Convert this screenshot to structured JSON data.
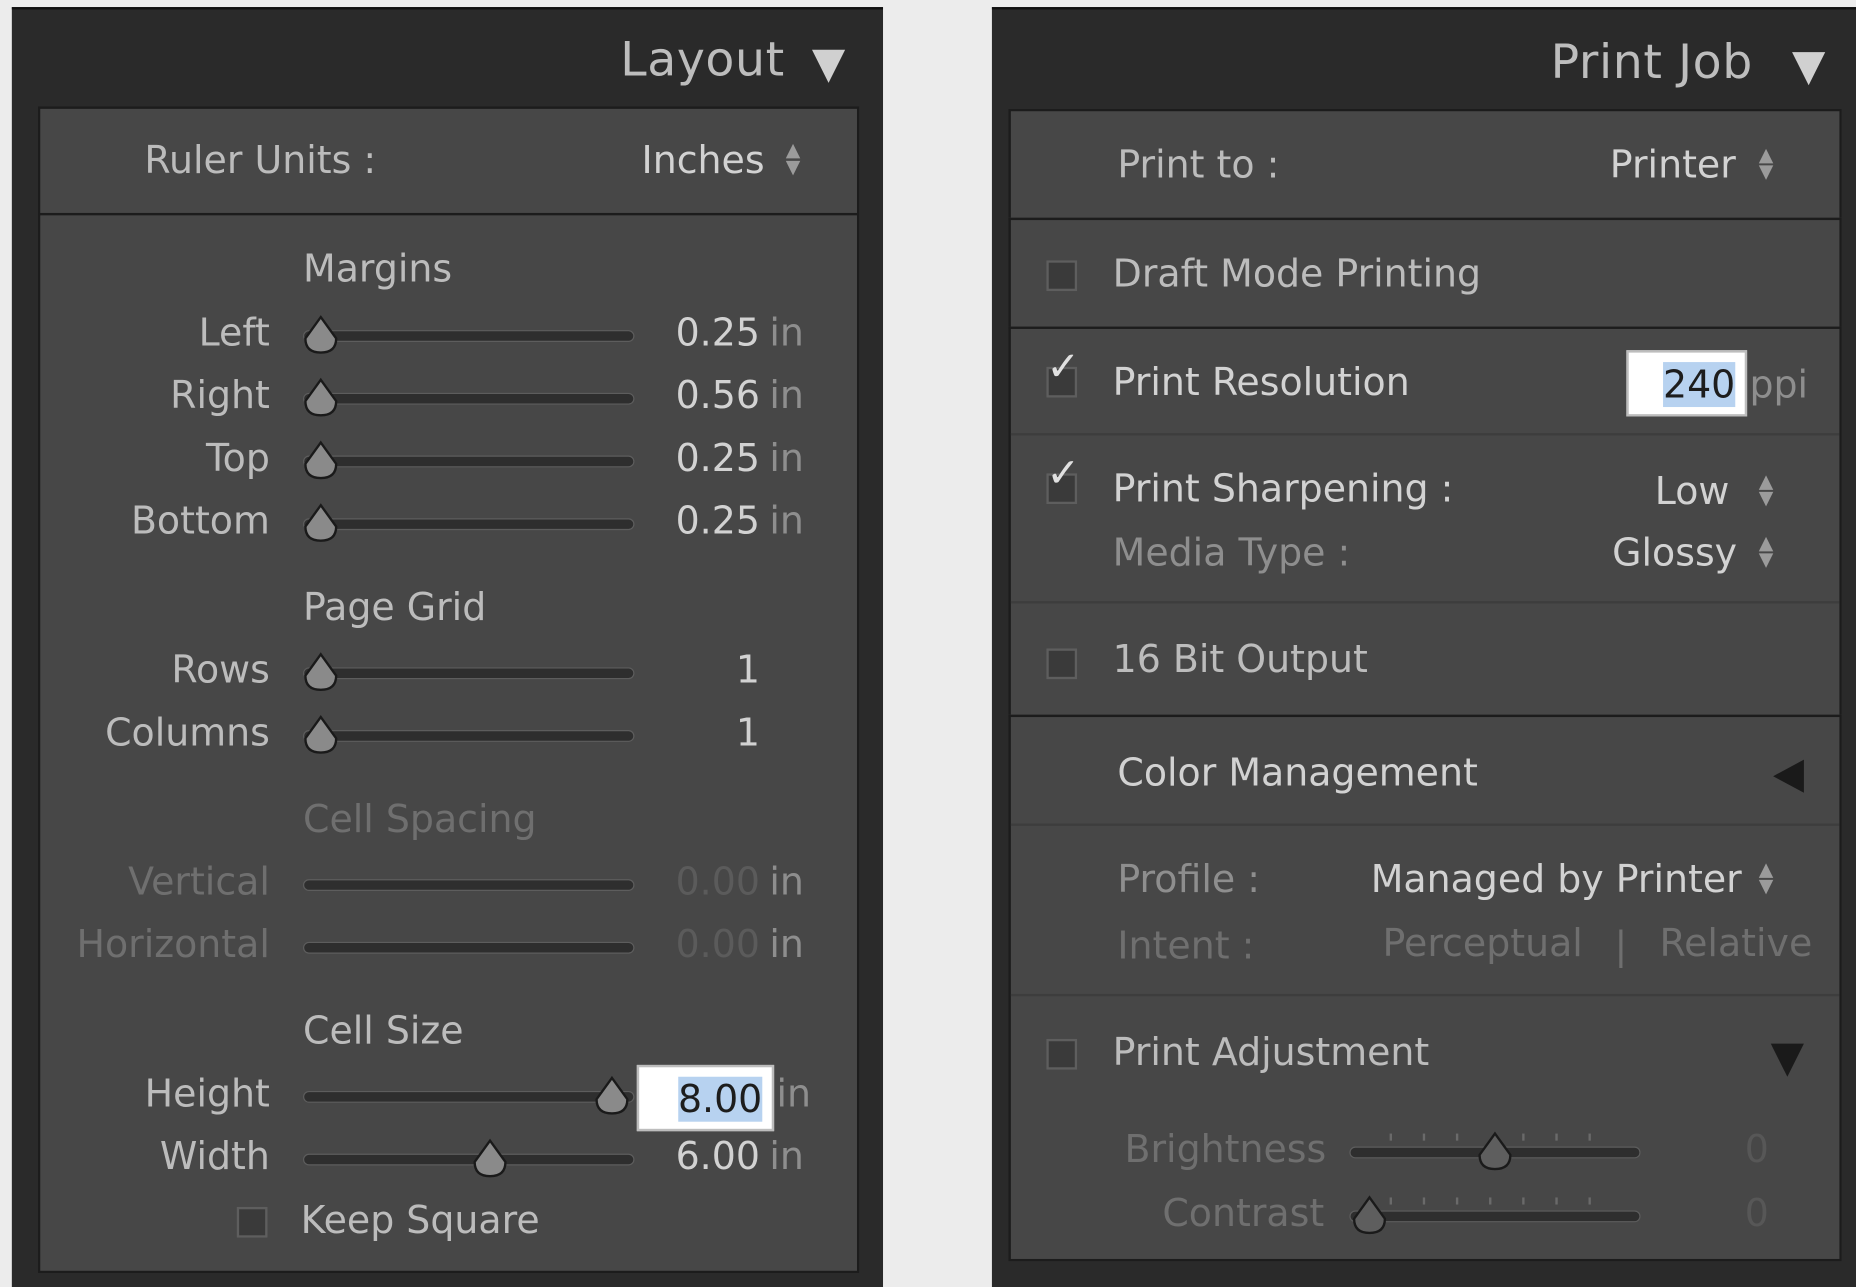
{
  "layout": {
    "title": "Layout",
    "ruler_units_label": "Ruler Units :",
    "ruler_units_value": "Inches",
    "margins": {
      "title": "Margins",
      "items": [
        {
          "label": "Left",
          "value": "0.25",
          "unit": "in"
        },
        {
          "label": "Right",
          "value": "0.56",
          "unit": "in"
        },
        {
          "label": "Top",
          "value": "0.25",
          "unit": "in"
        },
        {
          "label": "Bottom",
          "value": "0.25",
          "unit": "in"
        }
      ]
    },
    "page_grid": {
      "title": "Page Grid",
      "items": [
        {
          "label": "Rows",
          "value": "1"
        },
        {
          "label": "Columns",
          "value": "1"
        }
      ]
    },
    "cell_spacing": {
      "title": "Cell Spacing",
      "items": [
        {
          "label": "Vertical",
          "value": "0.00",
          "unit": "in"
        },
        {
          "label": "Horizontal",
          "value": "0.00",
          "unit": "in"
        }
      ]
    },
    "cell_size": {
      "title": "Cell Size",
      "items": [
        {
          "label": "Height",
          "value": "8.00",
          "unit": "in"
        },
        {
          "label": "Width",
          "value": "6.00",
          "unit": "in"
        }
      ]
    },
    "keep_square_label": "Keep Square"
  },
  "print_job": {
    "title": "Print Job",
    "print_to_label": "Print to :",
    "print_to_value": "Printer",
    "draft_mode_label": "Draft Mode Printing",
    "print_resolution_label": "Print Resolution",
    "print_resolution_value": "240",
    "print_resolution_unit": "ppi",
    "print_sharpening_label": "Print Sharpening :",
    "print_sharpening_value": "Low",
    "media_type_label": "Media Type :",
    "media_type_value": "Glossy",
    "bit_output_label": "16 Bit Output",
    "color_management_title": "Color Management",
    "profile_label": "Profile :",
    "profile_value": "Managed by Printer",
    "intent_label": "Intent :",
    "intent_perceptual": "Perceptual",
    "intent_separator": "|",
    "intent_relative": "Relative",
    "print_adjustment_label": "Print Adjustment",
    "brightness_label": "Brightness",
    "brightness_value": "0",
    "contrast_label": "Contrast",
    "contrast_value": "0"
  }
}
